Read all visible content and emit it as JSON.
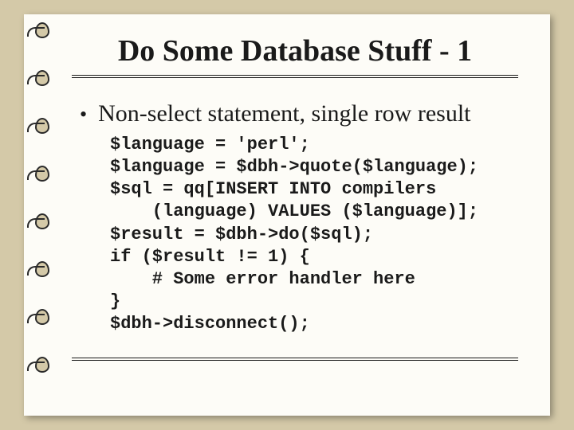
{
  "slide": {
    "title": "Do Some Database Stuff - 1",
    "bullet": "Non-select statement, single row result",
    "code": "$language = 'perl';\n$language = $dbh->quote($language);\n$sql = qq[INSERT INTO compilers\n    (language) VALUES ($language)];\n$result = $dbh->do($sql);\nif ($result != 1) {\n    # Some error handler here\n}\n$dbh->disconnect();"
  }
}
